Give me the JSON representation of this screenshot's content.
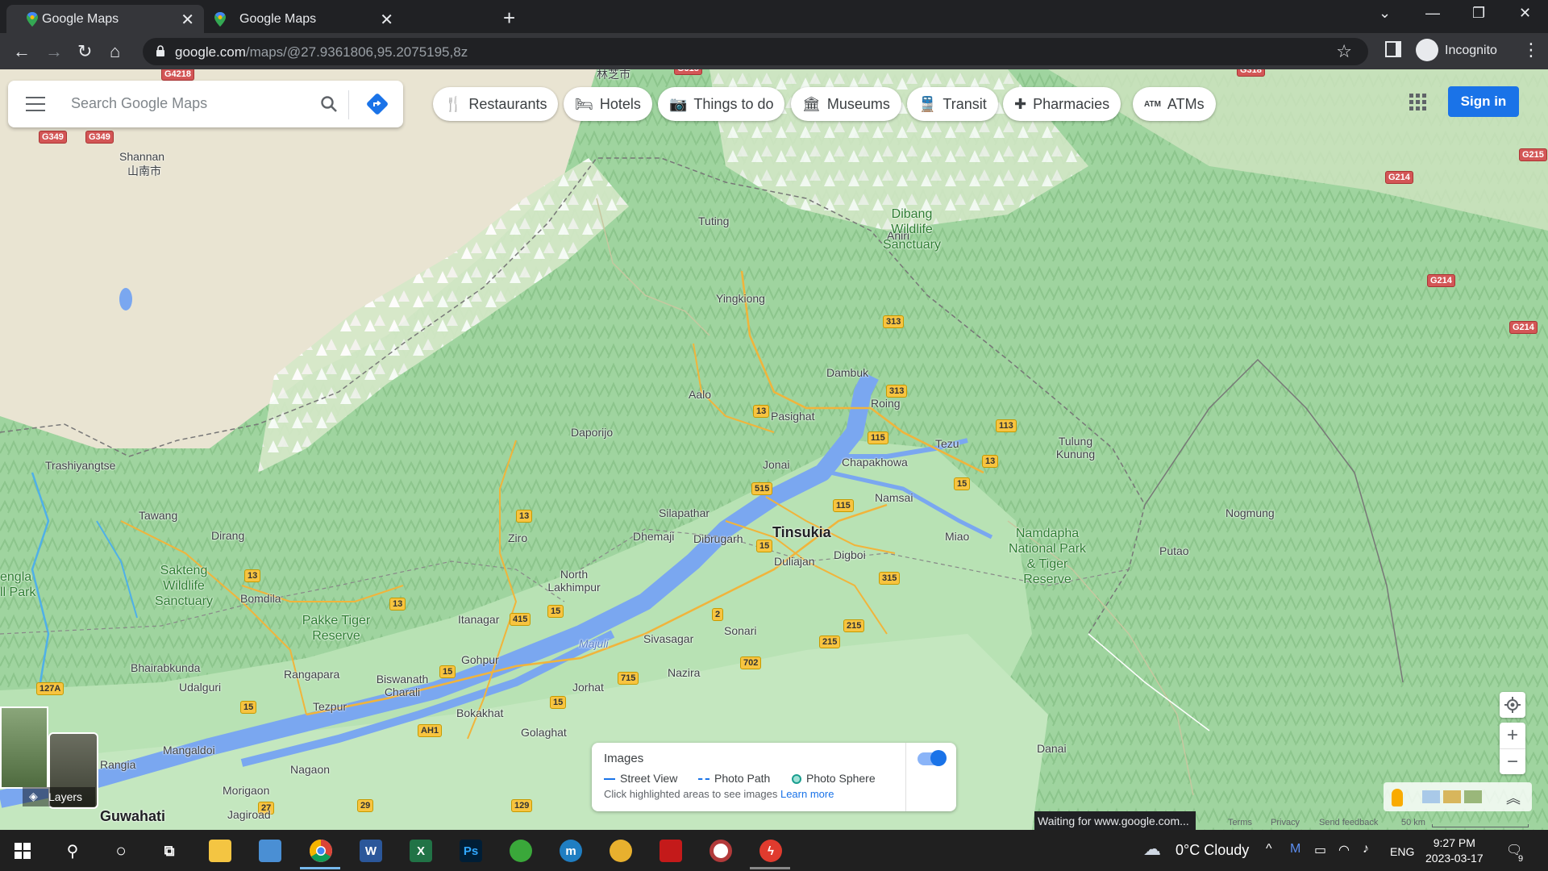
{
  "browser": {
    "tabs": [
      {
        "title": "Google Maps",
        "close": "✕"
      },
      {
        "title": "Google Maps",
        "close": "✕"
      }
    ],
    "new_tab": "+",
    "address": {
      "domain": "google.com",
      "path": "/maps/@27.9361806,95.2075195,8z"
    },
    "profile_label": "Incognito"
  },
  "maps": {
    "search_placeholder": "Search Google Maps",
    "chips": [
      {
        "label": "Restaurants",
        "icon": "restaurant-icon"
      },
      {
        "label": "Hotels",
        "icon": "hotel-icon"
      },
      {
        "label": "Things to do",
        "icon": "camera-icon"
      },
      {
        "label": "Museums",
        "icon": "museum-icon"
      },
      {
        "label": "Transit",
        "icon": "transit-icon"
      },
      {
        "label": "Pharmacies",
        "icon": "pharmacy-icon"
      },
      {
        "label": "ATMs",
        "icon": "atm-icon"
      }
    ],
    "sign_in": "Sign in",
    "layers_label": "Layers",
    "images_panel": {
      "title": "Images",
      "legend": [
        "Street View",
        "Photo Path",
        "Photo Sphere"
      ],
      "hint": "Click highlighted areas to see images",
      "learn_more": "Learn more",
      "toggle_on": true
    },
    "zoom_in": "+",
    "zoom_out": "−",
    "status": "Waiting for www.google.com...",
    "footer": [
      "Terms",
      "Privacy",
      "Send feedback",
      "50 km"
    ],
    "places": [
      {
        "name": "Shannan",
        "sub": "山南市"
      },
      {
        "name": "Tuting"
      },
      {
        "name": "Yingkiong"
      },
      {
        "name": "Aniri"
      },
      {
        "name": "Dambuk"
      },
      {
        "name": "Aalo"
      },
      {
        "name": "Pasighat"
      },
      {
        "name": "Roing"
      },
      {
        "name": "Tezu"
      },
      {
        "name": "Tulung Kunung"
      },
      {
        "name": "Daporijo"
      },
      {
        "name": "Jonai"
      },
      {
        "name": "Chapakhowa"
      },
      {
        "name": "Namsai"
      },
      {
        "name": "Trashiyangtse"
      },
      {
        "name": "Tawang"
      },
      {
        "name": "Silapathar"
      },
      {
        "name": "Ziro"
      },
      {
        "name": "Dhemaji"
      },
      {
        "name": "Dibrugarh"
      },
      {
        "name": "Tinsukia"
      },
      {
        "name": "Miao"
      },
      {
        "name": "Nogmung"
      },
      {
        "name": "Duliajan"
      },
      {
        "name": "Digboi"
      },
      {
        "name": "Putao"
      },
      {
        "name": "Dirang"
      },
      {
        "name": "North Lakhimpur"
      },
      {
        "name": "Bomdila"
      },
      {
        "name": "Itanagar"
      },
      {
        "name": "Sonari"
      },
      {
        "name": "Majuli"
      },
      {
        "name": "Sivasagar"
      },
      {
        "name": "Bhairabkunda"
      },
      {
        "name": "Rangapara"
      },
      {
        "name": "Gohpur"
      },
      {
        "name": "Nazira"
      },
      {
        "name": "Udalguri"
      },
      {
        "name": "Biswanath Charali"
      },
      {
        "name": "Jorhat"
      },
      {
        "name": "Tezpur"
      },
      {
        "name": "Bokakhat"
      },
      {
        "name": "Golaghat"
      },
      {
        "name": "Mangaldoi"
      },
      {
        "name": "Rangia"
      },
      {
        "name": "Nagaon"
      },
      {
        "name": "Morigaon"
      },
      {
        "name": "Guwahati"
      },
      {
        "name": "Jagiroad"
      },
      {
        "name": "Danai"
      },
      {
        "name": "林芝市"
      }
    ],
    "parks": [
      "Dibang Wildlife Sanctuary",
      "Namdapha National Park & Tiger Reserve",
      "Sakteng Wildlife Sanctuary",
      "Pakke Tiger Reserve",
      "engla ll Park"
    ]
  },
  "taskbar": {
    "weather": "0°C  Cloudy",
    "language": "ENG",
    "time": "9:27 PM",
    "date": "2023-03-17",
    "notifications": "9"
  }
}
